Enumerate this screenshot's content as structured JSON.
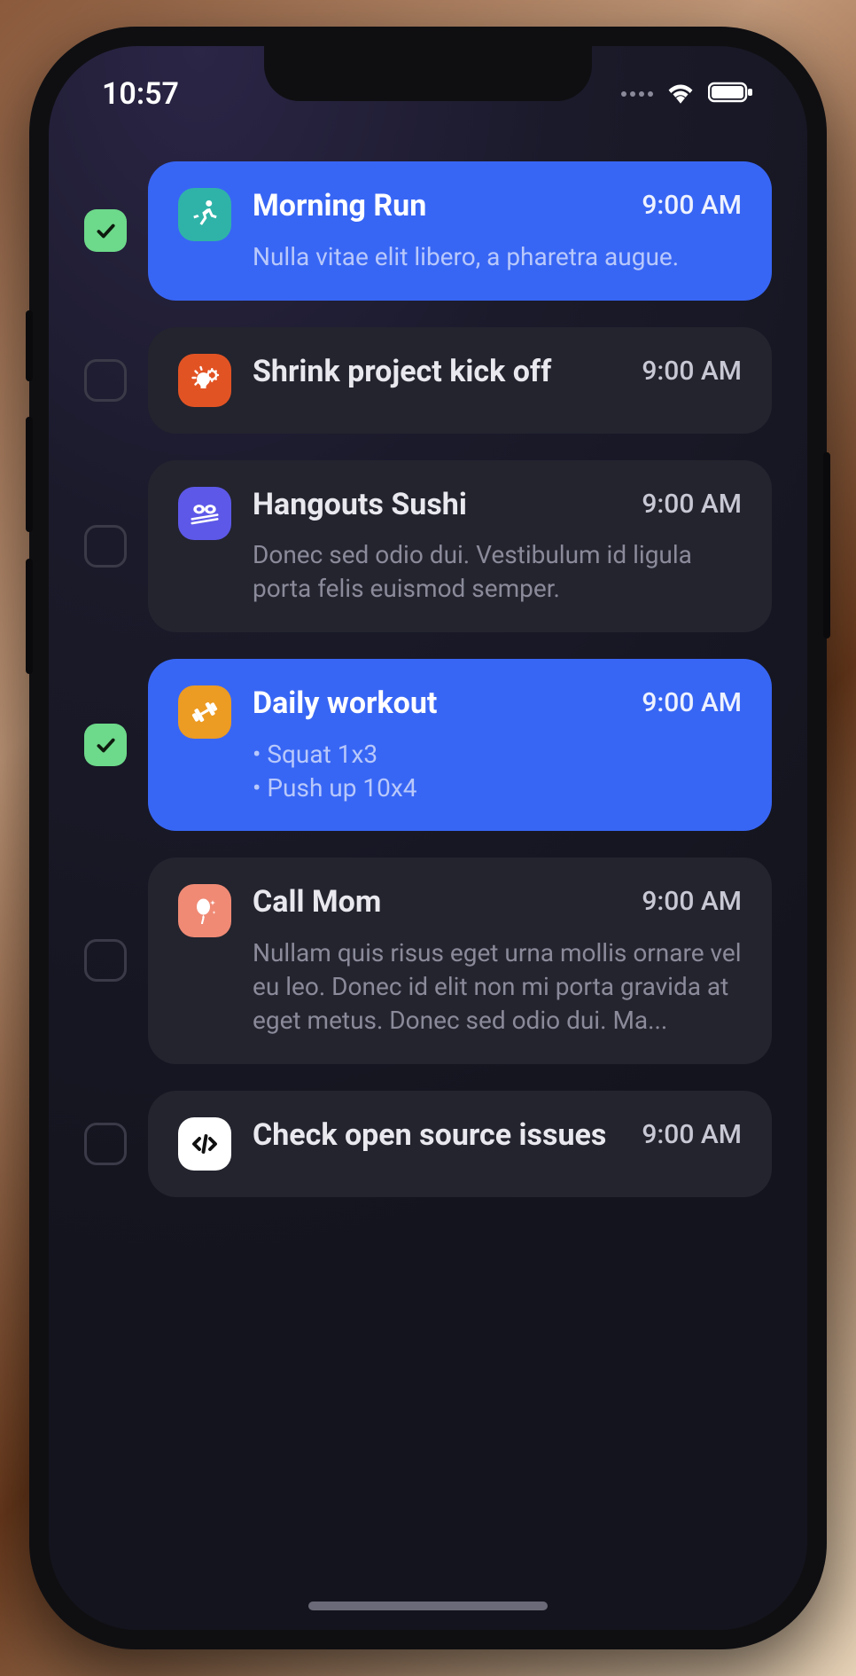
{
  "status": {
    "time": "10:57"
  },
  "tasks": [
    {
      "checked": true,
      "active": true,
      "icon": {
        "name": "running-icon",
        "bg": "#2fb3a8",
        "fg": "#ffffff"
      },
      "title": "Morning Run",
      "time": "9:00 AM",
      "desc": "Nulla vitae elit libero, a pharetra augue."
    },
    {
      "checked": false,
      "active": false,
      "icon": {
        "name": "idea-gear-icon",
        "bg": "#e25324",
        "fg": "#ffffff"
      },
      "title": "Shrink project kick off",
      "time": "9:00 AM",
      "desc": ""
    },
    {
      "checked": false,
      "active": false,
      "icon": {
        "name": "sushi-icon",
        "bg": "#5d58e8",
        "fg": "#ffffff"
      },
      "title": "Hangouts Sushi",
      "time": "9:00 AM",
      "desc": "Donec sed odio dui. Vestibulum id ligula porta felis euismod semper."
    },
    {
      "checked": true,
      "active": true,
      "icon": {
        "name": "dumbbell-icon",
        "bg": "#ec9b23",
        "fg": "#ffffff"
      },
      "title": "Daily workout",
      "time": "9:00 AM",
      "desc": " • Squat 1x3\n • Push up 10x4"
    },
    {
      "checked": false,
      "active": false,
      "icon": {
        "name": "balloon-icon",
        "bg": "#f08a75",
        "fg": "#ffffff"
      },
      "title": "Call Mom",
      "time": "9:00 AM",
      "desc": "Nullam quis risus eget urna mollis ornare vel eu leo. Donec id elit non mi porta gravida at eget metus. Donec sed odio dui. Ma..."
    },
    {
      "checked": false,
      "active": false,
      "icon": {
        "name": "code-icon",
        "bg": "#ffffff",
        "fg": "#111111"
      },
      "title": "Check open source issues",
      "time": "9:00 AM",
      "desc": ""
    }
  ]
}
